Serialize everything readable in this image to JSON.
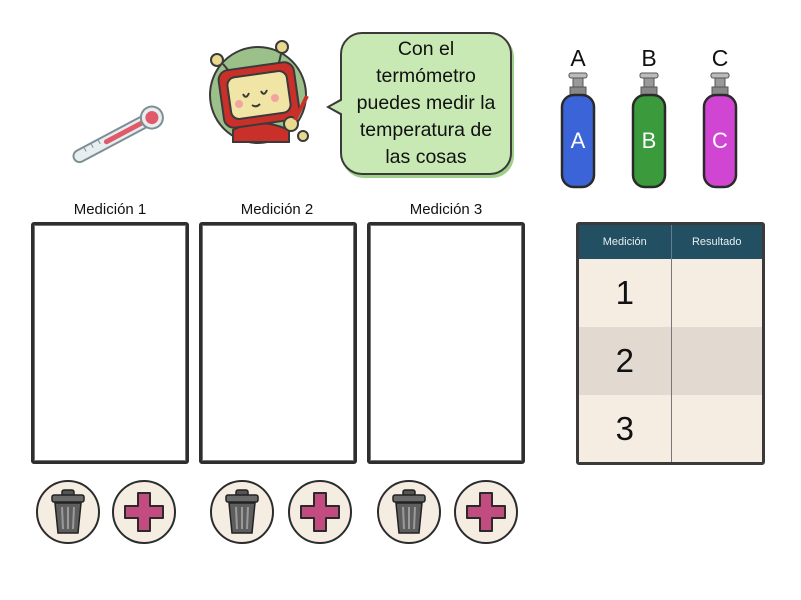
{
  "speech": {
    "text": "Con el termómetro puedes medir la temperatura de las cosas"
  },
  "tanks": [
    {
      "letter": "A",
      "badge": "A",
      "color": "#3a64d8"
    },
    {
      "letter": "B",
      "badge": "B",
      "color": "#3a9a3c"
    },
    {
      "letter": "C",
      "badge": "C",
      "color": "#d046d2"
    }
  ],
  "slots": [
    {
      "label": "Medición 1"
    },
    {
      "label": "Medición 2"
    },
    {
      "label": "Medición 3"
    }
  ],
  "buttons": {
    "trash_icon": "trash-icon",
    "add_icon": "plus-icon",
    "add_color": "#c24b80"
  },
  "results": {
    "headers": [
      "Medición",
      "Resultado"
    ],
    "rows": [
      {
        "measurement": "1",
        "result": ""
      },
      {
        "measurement": "2",
        "result": ""
      },
      {
        "measurement": "3",
        "result": ""
      }
    ],
    "header_color": "#234f62"
  }
}
